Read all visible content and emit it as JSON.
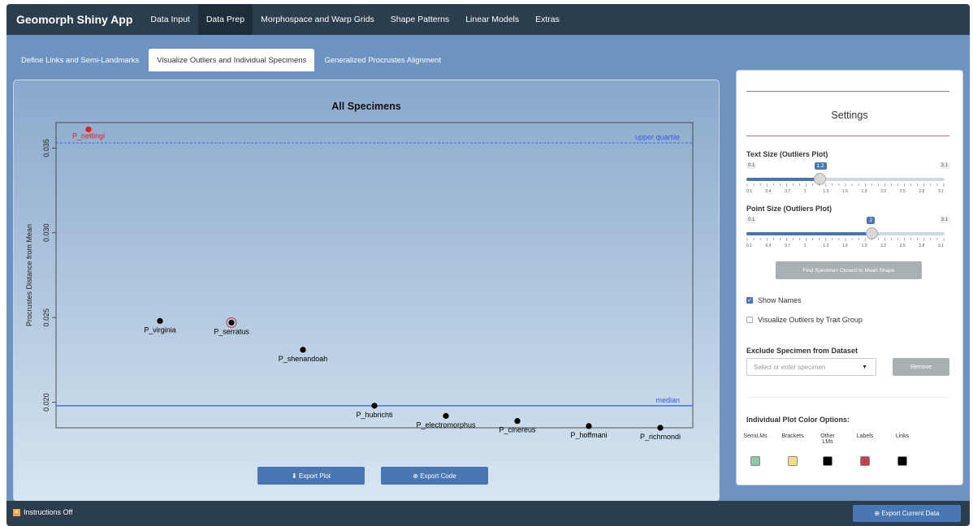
{
  "navbar": {
    "brand": "Geomorph Shiny App",
    "items": [
      "Data Input",
      "Data Prep",
      "Morphospace and Warp Grids",
      "Shape Patterns",
      "Linear Models",
      "Extras"
    ]
  },
  "tabs": [
    "Define Links and Semi-Landmarks",
    "Visualize Outliers and Individual Specimens",
    "Generalized Procrustes Alignment"
  ],
  "plot": {
    "ylabel": "Procrustes Distance from Mean",
    "export_plot_label": "⬇ Export Plot",
    "export_code_label": "⊕ Export Code"
  },
  "chart_data": {
    "type": "scatter",
    "title": "All Specimens",
    "xlabel": "",
    "ylabel": "Procrustes Distance from Mean",
    "ylim": [
      0.0185,
      0.0365
    ],
    "yticks": [
      0.02,
      0.025,
      0.03,
      0.035
    ],
    "ytick_labels": [
      "0.020",
      "0.025",
      "0.030",
      "0.035"
    ],
    "grid": false,
    "reference_lines": [
      {
        "label": "upper quartile",
        "y": 0.0353,
        "color": "#3a5bd9",
        "style": "dashed"
      },
      {
        "label": "median",
        "y": 0.0198,
        "color": "#3a5bd9",
        "style": "solid"
      }
    ],
    "points": [
      {
        "label": "P_nettingi",
        "x": 1,
        "y": 0.0361,
        "color": "#e02020",
        "highlight": false
      },
      {
        "label": "P_virginia",
        "x": 2,
        "y": 0.0248,
        "color": "#000000",
        "highlight": false
      },
      {
        "label": "P_serratus",
        "x": 3,
        "y": 0.0247,
        "color": "#000000",
        "highlight": true
      },
      {
        "label": "P_shenandoah",
        "x": 4,
        "y": 0.0231,
        "color": "#000000",
        "highlight": false
      },
      {
        "label": "P_hubrichti",
        "x": 5,
        "y": 0.0198,
        "color": "#000000",
        "highlight": false
      },
      {
        "label": "P_electromorphus",
        "x": 6,
        "y": 0.0192,
        "color": "#000000",
        "highlight": false
      },
      {
        "label": "P_cinereus",
        "x": 7,
        "y": 0.0189,
        "color": "#000000",
        "highlight": false
      },
      {
        "label": "P_hoffmani",
        "x": 8,
        "y": 0.0186,
        "color": "#000000",
        "highlight": false
      },
      {
        "label": "P_richmondi",
        "x": 9,
        "y": 0.0185,
        "color": "#000000",
        "highlight": false
      }
    ]
  },
  "settings": {
    "title": "Settings",
    "text_size": {
      "label": "Text Size (Outliers Plot)",
      "min": "0.1",
      "max": "3.1",
      "value": "1.2",
      "fraction": 0.367
    },
    "point_size": {
      "label": "Point Size (Outliers Plot)",
      "min": "0.1",
      "max": "3.1",
      "value": "2",
      "fraction": 0.633
    },
    "tick_labels": [
      "0.1",
      "0.4",
      "0.7",
      "1",
      "1.3",
      "1.6",
      "1.9",
      "2.2",
      "2.5",
      "2.8",
      "3.1"
    ],
    "find_button": "Find Specimen Closest to Mean Shape",
    "show_names": {
      "label": "Show Names",
      "checked": true
    },
    "visualize_outliers": {
      "label": "Visualize Outliers by Trait Group",
      "checked": false
    },
    "exclude_label": "Exclude Specimen from Dataset",
    "exclude_placeholder": "Select or enter specimen",
    "remove_button": "Remove",
    "color_options_label": "Individual Plot Color Options:",
    "color_columns": [
      {
        "label": "SemiLMs",
        "color": "#8fc9a3"
      },
      {
        "label": "Brackets",
        "color": "#f2dc8c"
      },
      {
        "label": "Other LMs",
        "color": "#000000"
      },
      {
        "label": "Labels",
        "color": "#c0404f"
      },
      {
        "label": "Links",
        "color": "#000000"
      }
    ]
  },
  "footer": {
    "instructions": "Instructions Off",
    "export_data": "⊕ Export Current Data"
  }
}
